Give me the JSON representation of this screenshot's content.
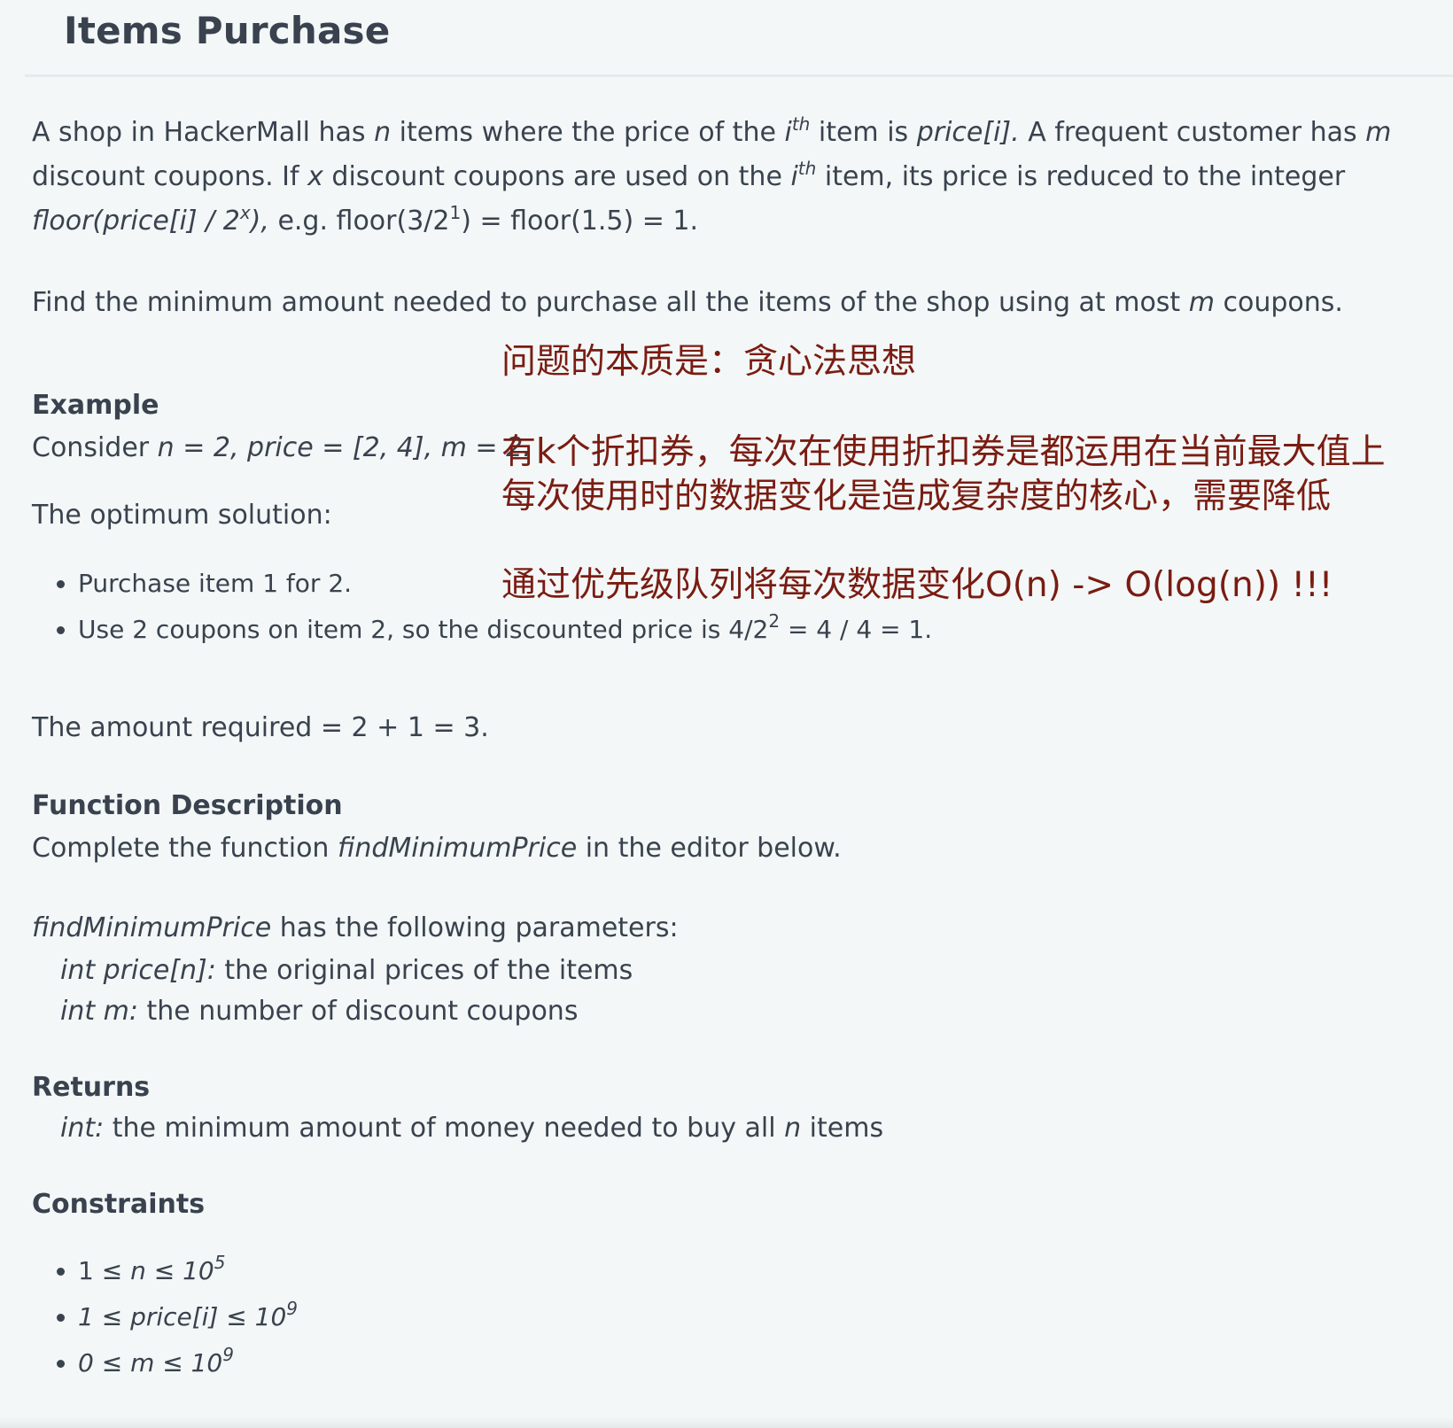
{
  "title": "Items Purchase",
  "intro": {
    "p1_a": "A shop in HackerMall has ",
    "n": "n",
    "p1_b": " items where the price of the ",
    "i": "i",
    "th": "th",
    "p1_c": " item is ",
    "price_i": "price[i].",
    "p1_d": " A frequent customer has ",
    "m": "m",
    "p1_e": " discount coupons. If ",
    "x": "x",
    "p1_f": " discount coupons are used on the ",
    "p1_g": " item, its price is reduced to the integer ",
    "floor_expr": "floor(price[i] / 2",
    "floor_sup": "x",
    "floor_end": "),",
    "p1_h": " e.g. floor(3/2",
    "eg_sup": "1",
    "p1_i": ") = floor(1.5) = 1."
  },
  "task": {
    "a": "Find the minimum amount needed to purchase all the items of the shop using at most ",
    "m": "m",
    "b": " coupons."
  },
  "example": {
    "heading": "Example",
    "consider": "Consider ",
    "values": "n = 2, price = [2, 4], m = 2.",
    "optimum": "The optimum solution:",
    "bullet1": "Purchase item 1 for 2.",
    "bullet2_a": "Use 2 coupons on item 2, so the discounted price is 4/2",
    "bullet2_sup": "2",
    "bullet2_b": " = 4 / 4 = 1.",
    "amount": "The amount required = 2 + 1 = 3."
  },
  "function_description": {
    "heading": "Function Description",
    "complete_a": "Complete the function ",
    "fname": "findMinimumPrice",
    "complete_b": " in the editor below.",
    "params_name": "findMinimumPrice",
    "params_b": " has the following parameters:",
    "param1_name": "int price[n]:",
    "param1_desc": " the original prices of the items",
    "param2_name": "int m:",
    "param2_desc": " the number of discount coupons"
  },
  "returns": {
    "heading": "Returns",
    "type": "int:",
    "desc_a": " the minimum amount of money needed to buy all ",
    "n": "n",
    "desc_b": " items"
  },
  "constraints": {
    "heading": "Constraints",
    "c1_a": "1 ≤ ",
    "c1_b": "n ≤ 10",
    "c1_sup": "5",
    "c2": "1 ≤ price[i] ≤ 10",
    "c2_sup": "9",
    "c3": "0 ≤ m ≤ 10",
    "c3_sup": "9"
  },
  "annotations": {
    "line1": "问题的本质是：贪心法思想",
    "line2": "有k个折扣券，每次在使用折扣券是都运用在当前最大值上",
    "line3": "每次使用时的数据变化是造成复杂度的核心，需要降低",
    "line4": "通过优先级队列将每次数据变化O(n) -> O(log(n)) !!!"
  },
  "colors": {
    "background": "#f3f7f7",
    "text": "#39424e",
    "annotation": "#7a1c12"
  }
}
